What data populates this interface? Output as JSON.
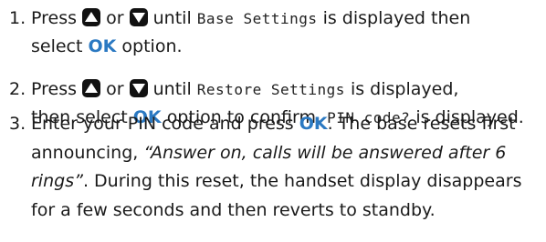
{
  "steps": [
    {
      "number": "1.",
      "press": "Press",
      "or": "or",
      "until": "until",
      "lcd": "Base Settings",
      "after_lcd": "is displayed then",
      "line2_pre": "select",
      "ok": "OK",
      "line2_post": "option."
    },
    {
      "number": "2.",
      "press": "Press",
      "or": "or",
      "until": "until",
      "lcd": "Restore Settings",
      "after_lcd": "is displayed,",
      "line2_pre": "then select",
      "ok": "OK",
      "line2_mid": "option to confirm.",
      "lcd2": "PIN code?",
      "line2_post": "is displayed."
    },
    {
      "number": "3.",
      "line1_pre": "Enter your PIN code and press",
      "ok": "OK",
      "line1_post": ". The base resets first",
      "line2_pre": "announcing,",
      "quote_a": "“Answer on, calls will be answered after 6",
      "quote_b": "rings”",
      "line3_post": ". During this reset, the handset display disappears",
      "line4": "for a few seconds and then reverts to standby."
    }
  ],
  "icons": {
    "up": "up-arrow-key-icon",
    "down": "down-arrow-key-icon"
  }
}
